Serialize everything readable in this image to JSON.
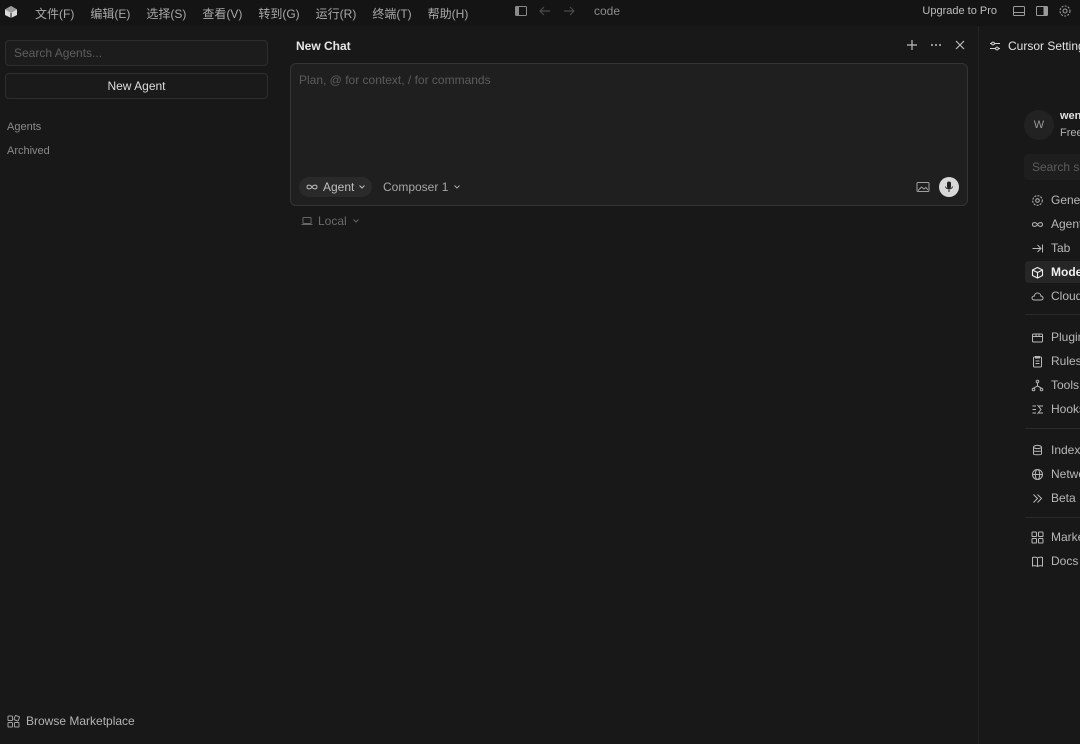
{
  "titlebar": {
    "menu": [
      "文件(F)",
      "编辑(E)",
      "选择(S)",
      "查看(V)",
      "转到(G)",
      "运行(R)",
      "终端(T)",
      "帮助(H)"
    ],
    "window_title": "code",
    "upgrade_label": "Upgrade to Pro"
  },
  "agents_panel": {
    "search_placeholder": "Search Agents...",
    "new_agent_label": "New Agent",
    "sections": [
      "Agents",
      "Archived"
    ],
    "browse_marketplace_label": "Browse Marketplace"
  },
  "chat": {
    "title": "New Chat",
    "composer_placeholder": "Plan, @ for context, / for commands",
    "mode_label": "Agent",
    "model_label": "Composer 1",
    "location_label": "Local"
  },
  "settings": {
    "title": "Cursor Settings",
    "user": {
      "initial": "W",
      "name": "wen",
      "plan": "Free"
    },
    "search_placeholder": "Search se",
    "nav": [
      {
        "label": "General",
        "icon": "gear-icon"
      },
      {
        "label": "Agents",
        "icon": "infinity-icon"
      },
      {
        "label": "Tab",
        "icon": "tab-arrow-icon"
      },
      {
        "label": "Models",
        "icon": "cube-icon",
        "active": true
      },
      {
        "label": "Cloud",
        "icon": "cloud-icon"
      },
      {
        "label": "Plugins",
        "icon": "box-icon"
      },
      {
        "label": "Rules,",
        "icon": "clipboard-icon"
      },
      {
        "label": "Tools",
        "icon": "branch-icon"
      },
      {
        "label": "Hooks",
        "icon": "hooks-icon"
      },
      {
        "label": "Index",
        "icon": "database-icon"
      },
      {
        "label": "Network",
        "icon": "globe-icon"
      },
      {
        "label": "Beta",
        "icon": "double-chevron-icon"
      },
      {
        "label": "Marketplace",
        "icon": "grid-icon"
      },
      {
        "label": "Docs",
        "icon": "book-icon"
      }
    ]
  }
}
